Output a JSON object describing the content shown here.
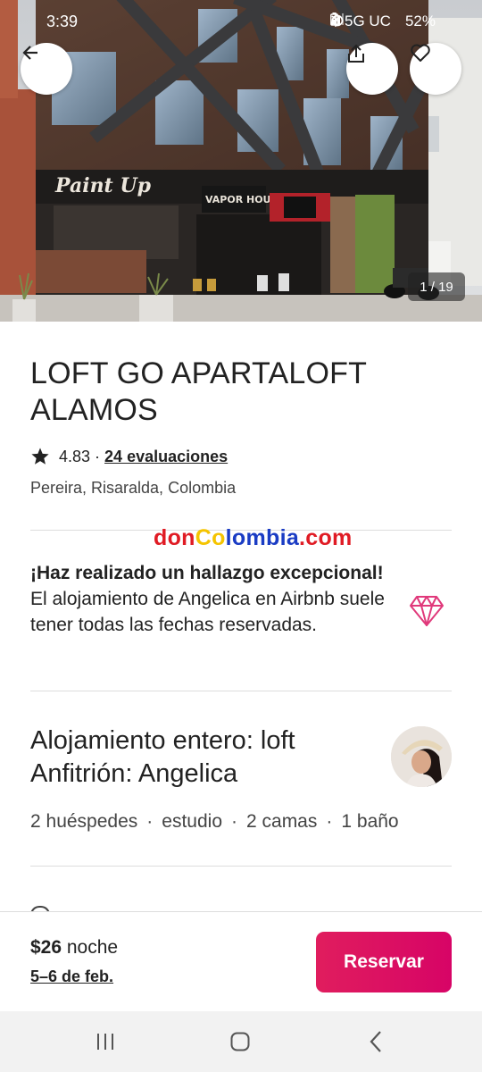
{
  "status_bar": {
    "time": "3:39",
    "network": "5G UC",
    "battery": "52%"
  },
  "hero": {
    "photo_counter": "1 / 19",
    "sign_paint": "Paint Up",
    "sign_vapor": "VAPOR HOUSE",
    "icons": [
      "arrow-left-icon",
      "share-icon",
      "heart-icon"
    ]
  },
  "listing": {
    "title": "LOFT GO APARTALOFT ALAMOS",
    "rating": "4.83",
    "rating_sep": "·",
    "reviews": "24 evaluaciones",
    "location": "Pereira, Risaralda, Colombia"
  },
  "watermark": {
    "part1": "don",
    "part2": "Co",
    "part3": "lombia",
    "part4": ".com"
  },
  "highlight": {
    "bold": "¡Haz realizado un hallazgo excepcional!",
    "text": " El alojamiento de Angelica en Airbnb suele tener todas las fechas reservadas."
  },
  "host": {
    "line1": "Alojamiento entero: loft",
    "line2": "Anfitrión: Angelica",
    "details": [
      "2 huéspedes",
      "estudio",
      "2 camas",
      "1 baño"
    ],
    "sep": "·"
  },
  "booking": {
    "price": "$26",
    "per": " noche",
    "dates": "5–6 de feb.",
    "reserve_label": "Reservar"
  },
  "colors": {
    "accent": "#E01D5E",
    "gem": "#E0397B",
    "text": "#222222",
    "muted": "#444444"
  }
}
